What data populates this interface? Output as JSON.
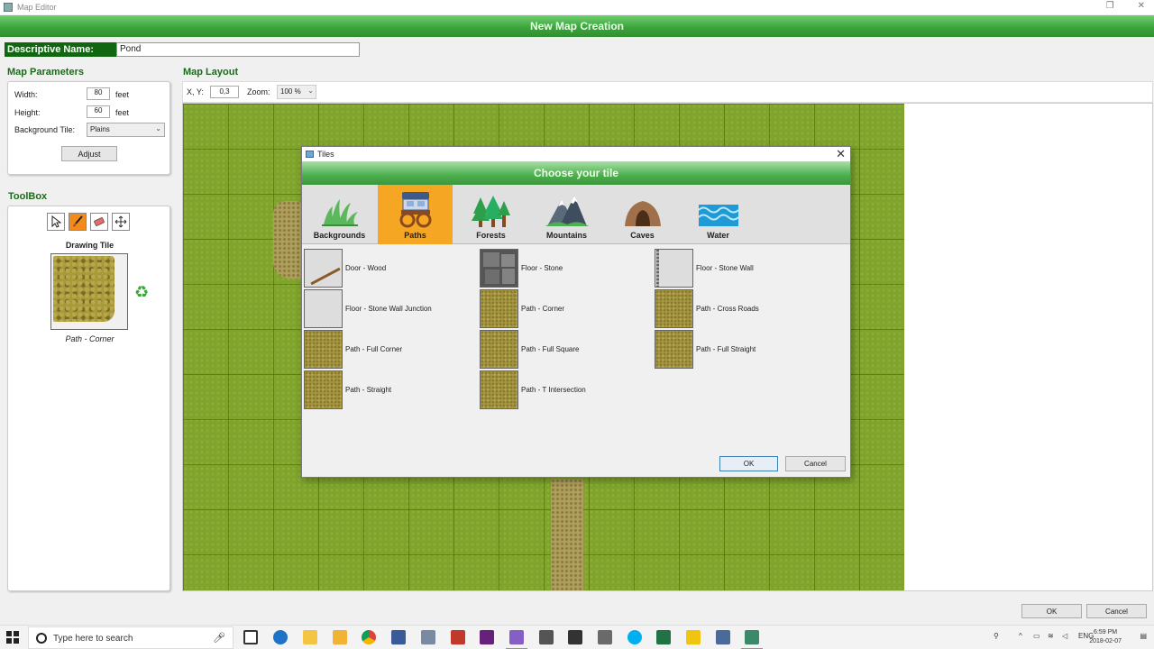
{
  "window": {
    "title": "Map Editor",
    "header": "New Map Creation"
  },
  "descriptive_name": {
    "label": "Descriptive Name:",
    "value": "Pond"
  },
  "map_parameters": {
    "title": "Map Parameters",
    "width_label": "Width:",
    "width_value": "80",
    "height_label": "Height:",
    "height_value": "60",
    "unit": "feet",
    "background_label": "Background Tile:",
    "background_value": "Plains",
    "adjust_label": "Adjust"
  },
  "toolbox": {
    "title": "ToolBox",
    "tools": [
      "pointer-icon",
      "brush-icon",
      "eraser-icon",
      "move-icon"
    ],
    "drawing_tile_label": "Drawing Tile",
    "drawing_tile_name": "Path - Corner"
  },
  "map_layout": {
    "title": "Map Layout",
    "xy_label": "X, Y:",
    "xy_value": "0,3",
    "zoom_label": "Zoom:",
    "zoom_value": "100 %"
  },
  "dialog": {
    "title": "Tiles",
    "header": "Choose your tile",
    "tabs": [
      {
        "label": "Backgrounds",
        "icon": "grass-icon"
      },
      {
        "label": "Paths",
        "icon": "wagon-icon",
        "active": true
      },
      {
        "label": "Forests",
        "icon": "trees-icon"
      },
      {
        "label": "Mountains",
        "icon": "mountain-icon"
      },
      {
        "label": "Caves",
        "icon": "cave-icon"
      },
      {
        "label": "Water",
        "icon": "waves-icon"
      }
    ],
    "tiles": [
      {
        "name": "Door - Wood",
        "kind": "wood"
      },
      {
        "name": "Floor - Stone",
        "kind": "stone"
      },
      {
        "name": "Floor - Stone Wall",
        "kind": "wall"
      },
      {
        "name": "Floor - Stone Wall Junction",
        "kind": "plain"
      },
      {
        "name": "Path - Corner",
        "kind": "path"
      },
      {
        "name": "Path - Cross Roads",
        "kind": "path"
      },
      {
        "name": "Path - Full Corner",
        "kind": "path"
      },
      {
        "name": "Path - Full Square",
        "kind": "path"
      },
      {
        "name": "Path - Full Straight",
        "kind": "path"
      },
      {
        "name": "Path - Straight",
        "kind": "path"
      },
      {
        "name": "Path - T Intersection",
        "kind": "path"
      }
    ],
    "ok_label": "OK",
    "cancel_label": "Cancel"
  },
  "footer": {
    "ok_label": "OK",
    "cancel_label": "Cancel"
  },
  "taskbar": {
    "search_placeholder": "Type here to search",
    "lang": "ENG",
    "time": "6:59 PM",
    "date": "2018-02-07"
  },
  "colors": {
    "header_green": "#3da53d",
    "label_green": "#1a6b1a",
    "active_tab": "#f5a623",
    "grass": "#7fa32d"
  }
}
